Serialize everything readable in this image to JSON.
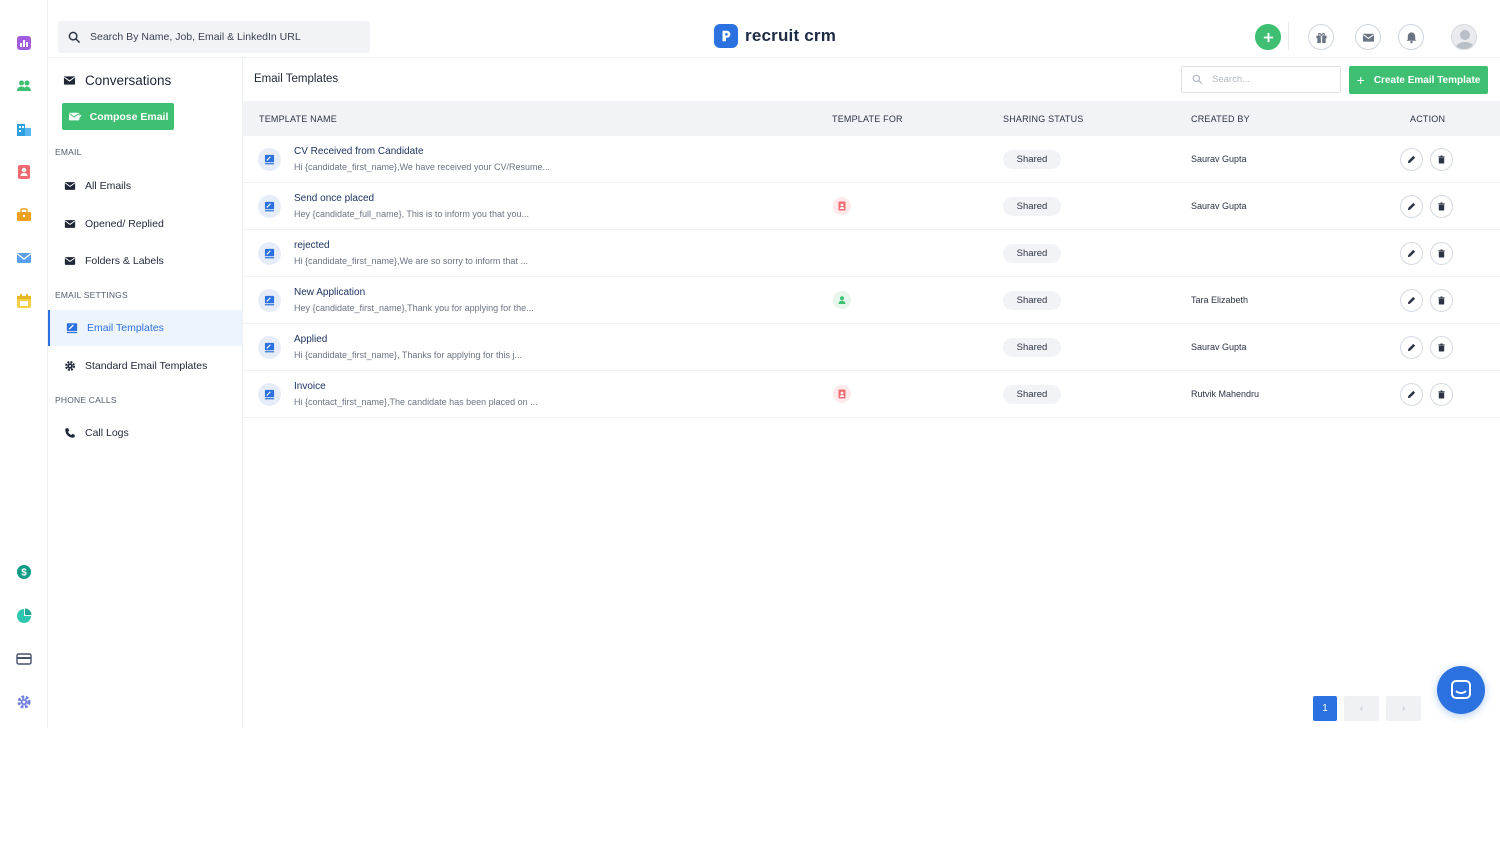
{
  "colors": {
    "accent": "#2b71e0",
    "primary_action": "#3fbf71",
    "table_header_bg": "#f1f3f7"
  },
  "topbar": {
    "search_placeholder": "Search By Name, Job, Email & LinkedIn URL",
    "logo_text": "recruit crm",
    "icons": [
      "plus-icon",
      "gift-icon",
      "mail-icon",
      "bell-icon",
      "avatar"
    ]
  },
  "rail": {
    "icons": [
      "dashboard-icon",
      "candidates-icon",
      "companies-icon",
      "contacts-icon",
      "jobs-icon",
      "email-icon",
      "calendar-icon",
      "billing-icon",
      "reports-icon",
      "card-icon",
      "settings-icon"
    ]
  },
  "sidebar": {
    "title": "Conversations",
    "compose_label": "Compose Email",
    "section_email": "EMAIL",
    "email_items": [
      {
        "label": "All Emails"
      },
      {
        "label": "Opened/ Replied"
      },
      {
        "label": "Folders & Labels"
      }
    ],
    "section_settings": "EMAIL SETTINGS",
    "settings_items": [
      {
        "label": "Email Templates",
        "active": true
      },
      {
        "label": "Standard Email Templates",
        "active": false
      }
    ],
    "section_phone": "PHONE CALLS",
    "phone_items": [
      {
        "label": "Call Logs"
      }
    ]
  },
  "main": {
    "title": "Email Templates",
    "search_placeholder": "Search...",
    "create_label": "Create Email Template",
    "create_prefix": "+",
    "columns": [
      "TEMPLATE NAME",
      "TEMPLATE FOR",
      "SHARING STATUS",
      "CREATED BY",
      "ACTION"
    ],
    "rows": [
      {
        "name": "CV Received from Candidate",
        "preview": "Hi {candidate_first_name},We have received your CV/Resume...",
        "template_for": "",
        "sharing": "Shared",
        "created_by": "Saurav Gupta"
      },
      {
        "name": "Send once placed",
        "preview": "Hey {candidate_full_name}, This is to inform you that you...",
        "template_for": "contact",
        "sharing": "Shared",
        "created_by": "Saurav Gupta"
      },
      {
        "name": "rejected",
        "preview": "Hi {candidate_first_name},We are so sorry to inform that ...",
        "template_for": "",
        "sharing": "Shared",
        "created_by": ""
      },
      {
        "name": "New Application",
        "preview": "Hey {candidate_first_name},Thank you for applying for the...",
        "template_for": "candidate",
        "sharing": "Shared",
        "created_by": "Tara Elizabeth"
      },
      {
        "name": "Applied",
        "preview": "Hi {candidate_first_name}, Thanks for applying for this j...",
        "template_for": "",
        "sharing": "Shared",
        "created_by": "Saurav Gupta"
      },
      {
        "name": "Invoice",
        "preview": "Hi {contact_first_name},The candidate has been placed on ...",
        "template_for": "contact",
        "sharing": "Shared",
        "created_by": "Rutvik Mahendru"
      }
    ],
    "pagination": {
      "current": "1",
      "prev": "‹",
      "next": "›"
    }
  }
}
